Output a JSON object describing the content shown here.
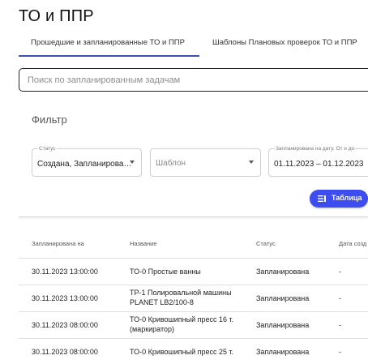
{
  "header": {
    "title": "ТО и ППР"
  },
  "tabs": [
    {
      "label": "Прошедшие и запланированные ТО и ППР",
      "active": true
    },
    {
      "label": "Шаблоны Плановых проверок ТО и ППР",
      "active": false
    }
  ],
  "search": {
    "placeholder": "Поиск по запланированным задачам",
    "value": ""
  },
  "filter": {
    "title": "Фильтр",
    "status": {
      "label": "Статус",
      "value": "Создана, Запланирова…"
    },
    "template": {
      "placeholder": "Шаблон",
      "value": ""
    },
    "date_range": {
      "label": "Запланирована на дату. От и до",
      "value": "01.11.2023 – 01.12.2023"
    }
  },
  "view_button": {
    "label": "Таблица",
    "icon": "table-list-icon"
  },
  "table": {
    "headers": [
      "Запланирована на",
      "Название",
      "Статус",
      "Дата созд"
    ],
    "rows": [
      {
        "date": "30.11.2023 13:00:00",
        "name": "ТО-0 Простые ванны",
        "status": "Запланирована",
        "created": "-"
      },
      {
        "date": "30.11.2023 13:00:00",
        "name": "ТР-1 Полировальной машины PLANET LB2/100-8",
        "status": "Запланирована",
        "created": "-"
      },
      {
        "date": "30.11.2023 08:00:00",
        "name": "ТО-0 Кривошипный пресс 16 т. (маркиратор)",
        "status": "Запланирована",
        "created": "-"
      },
      {
        "date": "30.11.2023 08:00:00",
        "name": "ТО-0 Кривошипный пресс 25 т.",
        "status": "Запланирована",
        "created": "-"
      }
    ]
  },
  "colors": {
    "accent": "#3f51b5",
    "button": "#3d4df0"
  }
}
